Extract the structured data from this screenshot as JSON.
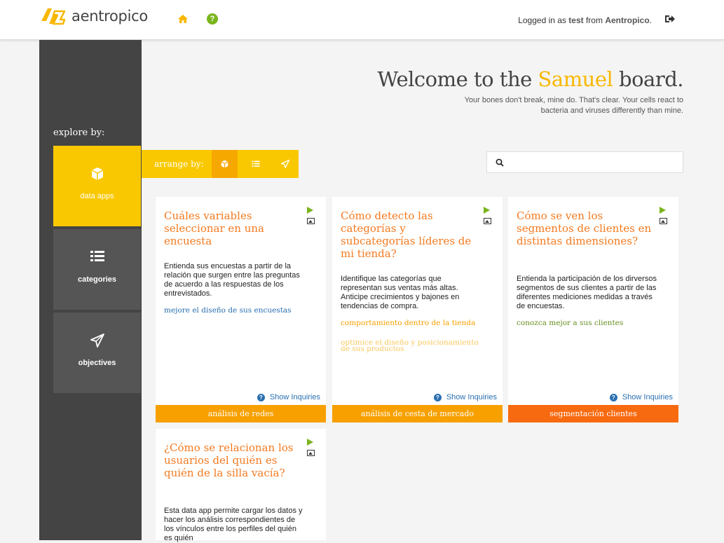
{
  "header": {
    "logo_text": "aentropico",
    "login_prefix": "Logged in as",
    "login_user": "test",
    "login_from": "from",
    "login_org": "Aentropico",
    "login_suffix": "."
  },
  "colors": {
    "accent_yellow": "#f9c800",
    "accent_orange": "#f47a20",
    "sidebar_dark": "#444444",
    "link_blue": "#2a6fb0",
    "icon_green": "#7ab51d"
  },
  "sidebar": {
    "explore_label": "explore by:",
    "items": [
      {
        "label": "data apps",
        "icon": "cube-icon"
      },
      {
        "label": "categories",
        "icon": "list-icon"
      },
      {
        "label": "objectives",
        "icon": "paper-plane-icon"
      }
    ]
  },
  "arrange": {
    "label": "arrange by:",
    "options": [
      "cube-icon",
      "list-icon",
      "paper-plane-icon"
    ]
  },
  "welcome": {
    "prefix": "Welcome to the",
    "name": "Samuel",
    "suffix": "board.",
    "subtitle": "Your bones don't break, mine do. That's clear. Your cells react to bacteria and viruses differently than mine."
  },
  "search": {
    "value": "",
    "placeholder": ""
  },
  "cards": [
    {
      "title": "Cuáles variables seleccionar en una encuesta",
      "description": "Entienda sus encuestas a partir de la relación que surgen entre las preguntas de acuerdo a las respuestas de los entrevistados.",
      "links": [
        "mejore el diseño de sus encuestas"
      ],
      "show_inquiries": "Show Inquiries",
      "footer": "análisis de redes"
    },
    {
      "title": "Cómo detecto las categorías y subcategorías líderes de mi tienda?",
      "description": "Identifique las categorías que representan sus ventas más altas. Anticipe crecimientos y bajones en tendencias de compra.",
      "links": [
        "comportamiento dentro de la tienda",
        "optimice el diseño y posicionamiento de sus productos"
      ],
      "show_inquiries": "Show Inquiries",
      "footer": "análisis de cesta de mercado"
    },
    {
      "title": "Cómo se ven los segmentos de clientes en distintas dimensiones?",
      "description": "Entienda la participación de los dirversos segmentos de sus clientes a partir de las diferentes mediciones medidas a través de encuestas.",
      "links": [
        "conozca mejor a sus clientes"
      ],
      "show_inquiries": "Show Inquiries",
      "footer": "segmentación clientes"
    },
    {
      "title": "¿Cómo se relacionan los usuarios del quién es quién de la silla vacía?",
      "description": "Esta data app permite cargar los datos y hacer los análisis correspondientes de los vínculos entre los perfiles del quién es quién"
    }
  ]
}
